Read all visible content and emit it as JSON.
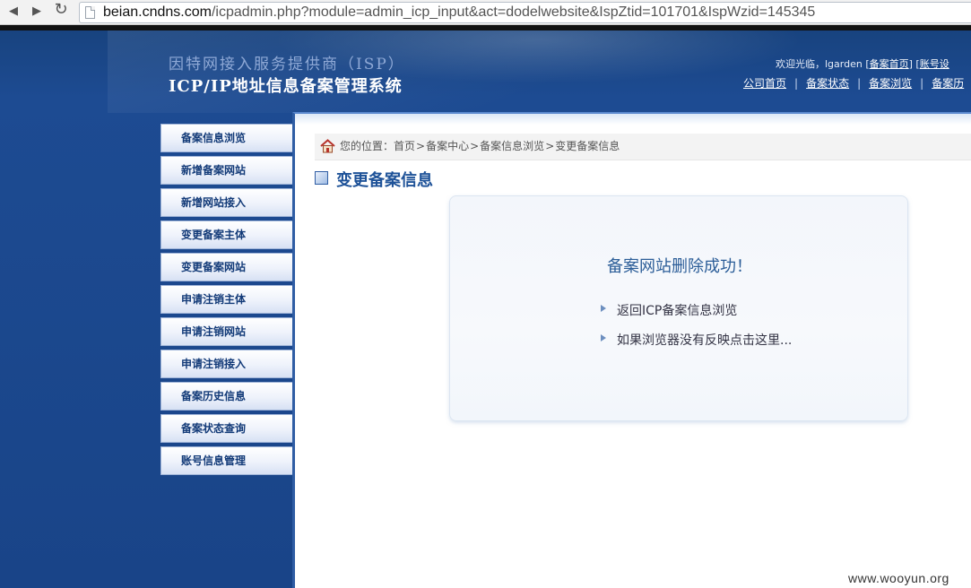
{
  "browser": {
    "url_host": "beian.cndns.com",
    "url_path": "/icpadmin.php?module=admin_icp_input&act=dodelwebsite&IspZtid=101701&IspWzid=145345"
  },
  "header": {
    "isp_line": "因特网接入服务提供商（ISP）",
    "system_title": "ICP/IP地址信息备案管理系统",
    "welcome_prefix": "欢迎光临，lgarden [",
    "welcome_link_home": "备案首页",
    "welcome_mid": "] [",
    "welcome_link_account": "账号设",
    "top_links": [
      "公司首页",
      "备案状态",
      "备案浏览",
      "备案历"
    ]
  },
  "sidebar": {
    "items": [
      {
        "label": "备案信息浏览"
      },
      {
        "label": "新增备案网站"
      },
      {
        "label": "新增网站接入"
      },
      {
        "label": "变更备案主体"
      },
      {
        "label": "变更备案网站"
      },
      {
        "label": "申请注销主体"
      },
      {
        "label": "申请注销网站"
      },
      {
        "label": "申请注销接入"
      },
      {
        "label": "备案历史信息"
      },
      {
        "label": "备案状态查询"
      },
      {
        "label": "账号信息管理"
      }
    ]
  },
  "breadcrumb": {
    "prefix": "您的位置：",
    "items": [
      "首页",
      "备案中心",
      "备案信息浏览",
      "变更备案信息"
    ],
    "separator": ">"
  },
  "main": {
    "section_title": "变更备案信息",
    "message": "备案网站删除成功！",
    "links": [
      "返回ICP备案信息浏览",
      "如果浏览器没有反映点击这里..."
    ]
  },
  "watermark": "www.wooyun.org",
  "colors": {
    "page_blue": "#1d4a93",
    "title_blue": "#1e5298",
    "sidebar_text": "#123a78"
  }
}
